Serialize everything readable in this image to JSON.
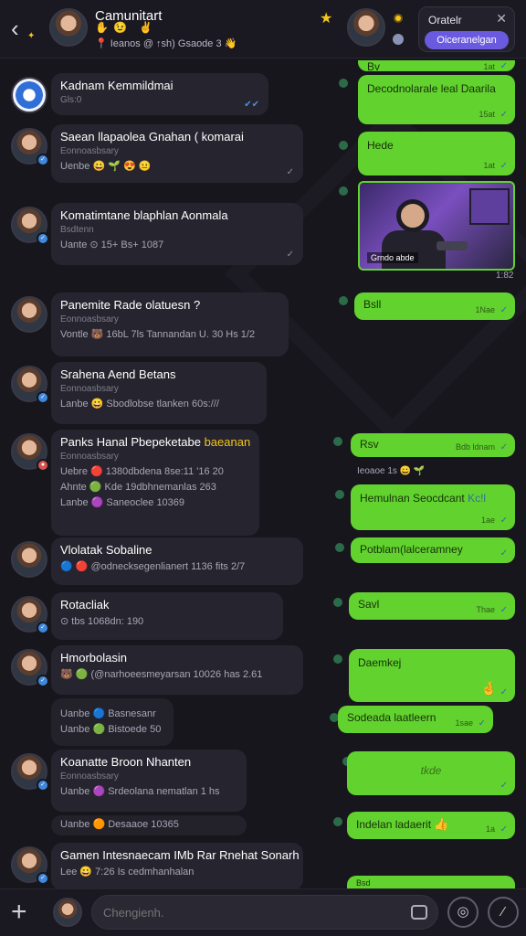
{
  "header": {
    "title": "Camunitart",
    "emoji_row": "✋😉 ✌",
    "subtitle": "📍 Ieanos @ ↑sh) Gsaode 3 👋",
    "panel_title": "Oratelr",
    "panel_button": "Oiceranelgan"
  },
  "chats": [
    {
      "title": "Kadnam Kemmildmai",
      "sub": "Gls:0",
      "lines": []
    },
    {
      "title": "Saean llapaolea Gnahan ( komarai",
      "sub": "Eonnoasbsary",
      "lines": [
        "Uenbe 😀 🌱 😍 😐"
      ]
    },
    {
      "title": "Komatimtane blaphlan Aonmala",
      "sub": "Bsdtenn",
      "lines": [
        "Uante ⊙ 15+ Bs+ 1087"
      ]
    },
    {
      "title": "Panemite Rade olatuesn ?",
      "sub": "Eonnoasbsary",
      "lines": [
        "Vontle 🐻 16bL 7ls Tannandan U. 30 Hs 1/2"
      ]
    },
    {
      "title": "Srahena Aend Betans",
      "sub": "Eonnoasbsary",
      "lines": [
        "Lanbe 😀 Sbodlobse tlanken 60s:///"
      ]
    },
    {
      "title": "Panks Hanal Pbepeketabe",
      "highlight": "baeanan",
      "sub": "Eonnoasbsary",
      "lines": [
        "Uebre 🔴 1380dbdena 8se:11 '16 20",
        "Ahnte 🟢 Kde 19dbhnemanlas 263",
        "Lanbe 🟣 Saneoclee 10369"
      ]
    },
    {
      "title": "Vlolatak Sobaline",
      "sub": "",
      "lines": [
        "🔵 🔴 @odnecksegenlianert 1136 fits 2/7"
      ]
    },
    {
      "title": "Rotacliak",
      "sub": "",
      "lines": [
        "⊙ tbs 1068dn: 190"
      ]
    },
    {
      "title": "Hmorbolasin",
      "sub": "",
      "lines": [
        "🐻 🟢 (@narhoeesmeyarsan 10026 has 2.61",
        "Uanbe 🔵 Basnesanr",
        "Uanbe 🟢 Bistoede 50"
      ]
    },
    {
      "title": "Koanatte Broon Nhanten",
      "sub": "Eonnoasbsary",
      "lines": [
        "Uanbe 🟣 Srdeolana nematlan 1 hs",
        "Uanbe 🟠 Desaaoe 10365"
      ]
    },
    {
      "title": "Gamen Intesnaecam IMb Rar Rnehat Sonarh",
      "sub": "",
      "lines": [
        "Lee 😀 7:26 Is cedmhanhalan"
      ]
    }
  ],
  "messages": [
    {
      "text": "Bv",
      "time": "1at",
      "check": "✓"
    },
    {
      "text": "Decodnolarale leal Daarila",
      "time": "15at",
      "check": "✓"
    },
    {
      "text": "Hede",
      "time": "1at",
      "check": "✓"
    },
    {
      "caption": "Grndo abde",
      "time": "1:82"
    },
    {
      "text": "Bsll",
      "time": "1Nae",
      "check": "✓"
    },
    {
      "text": "Rsv",
      "time": "Bdb ldnam",
      "check": "✓"
    },
    {
      "meta": "Ieoaoe 1s 😀 🌱"
    },
    {
      "text": "Hemulnan Seocdcant",
      "extra": "Kc!l",
      "time": "1ae",
      "check": "✓"
    },
    {
      "text": "Potblam(lalceramney",
      "time": "",
      "check": "✓"
    },
    {
      "text": "Savl",
      "time": "Thae",
      "check": "✓"
    },
    {
      "text": "Daemkej",
      "time": "",
      "check": "✓",
      "emoji": "🤞"
    },
    {
      "text": "Sodeada laatleern",
      "time": "1sae",
      "check": "✓"
    },
    {
      "text": "tkde",
      "time": "",
      "check": "✓"
    },
    {
      "text": "Indelan ladaerit",
      "time": "1a",
      "check": "✓",
      "emoji": "👍"
    },
    {
      "text": "Bsd"
    }
  ],
  "input": {
    "placeholder": "Chengienh."
  },
  "colors": {
    "bubble": "#62d22f",
    "accent": "#6a5ae0",
    "background": "#17161d",
    "card": "#26252f"
  }
}
